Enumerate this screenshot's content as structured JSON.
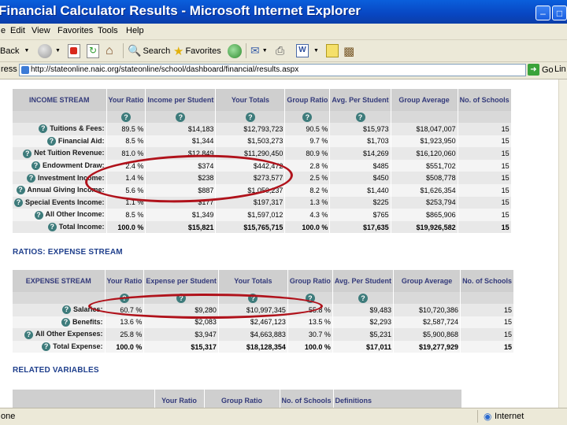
{
  "window": {
    "title": "Financial Calculator Results - Microsoft Internet Explorer"
  },
  "menu": [
    "Edit",
    "View",
    "Favorites",
    "Tools",
    "Help"
  ],
  "menu_fragment": "e",
  "toolbar": {
    "back": "Back",
    "search": "Search",
    "favorites": "Favorites"
  },
  "address": {
    "label_fragment": "ress",
    "url": "http://stateonline.naic.org/stateonline/school/dashboard/financial/results.aspx",
    "go": "Go",
    "links_fragment": "Lin"
  },
  "income": {
    "headers": [
      "INCOME STREAM",
      "Your Ratio",
      "Income per Student",
      "Your Totals",
      "Group Ratio",
      "Avg. Per Student",
      "Group Average",
      "No. of Schools"
    ],
    "rows": [
      [
        "Tuitions & Fees:",
        "89.5 %",
        "$14,183",
        "$12,793,723",
        "90.5 %",
        "$15,973",
        "$18,047,007",
        "15"
      ],
      [
        "Financial Aid:",
        "8.5 %",
        "$1,344",
        "$1,503,273",
        "9.7 %",
        "$1,703",
        "$1,923,950",
        "15"
      ],
      [
        "Net Tuition Revenue:",
        "81.0 %",
        "$12,849",
        "$11,290,450",
        "80.9 %",
        "$14,269",
        "$16,120,060",
        "15"
      ],
      [
        "Endowment Draw:",
        "2.4 %",
        "$374",
        "$442,472",
        "2.8 %",
        "$485",
        "$551,702",
        "15"
      ],
      [
        "Investment Income:",
        "1.4 %",
        "$238",
        "$273,577",
        "2.5 %",
        "$450",
        "$508,778",
        "15"
      ],
      [
        "Annual Giving Income:",
        "5.6 %",
        "$887",
        "$1,050,237",
        "8.2 %",
        "$1,440",
        "$1,626,354",
        "15"
      ],
      [
        "Special Events Income:",
        "1.1 %",
        "$177",
        "$197,317",
        "1.3 %",
        "$225",
        "$253,794",
        "15"
      ],
      [
        "All Other Income:",
        "8.5 %",
        "$1,349",
        "$1,597,012",
        "4.3 %",
        "$765",
        "$865,906",
        "15"
      ],
      [
        "Total Income:",
        "100.0 %",
        "$15,821",
        "$15,765,715",
        "100.0 %",
        "$17,635",
        "$19,926,582",
        "15"
      ]
    ]
  },
  "ratios_expense_title": "RATIOS: EXPENSE STREAM",
  "expense": {
    "headers": [
      "EXPENSE STREAM",
      "Your Ratio",
      "Expense per Student",
      "Your Totals",
      "Group Ratio",
      "Avg. Per Student",
      "Group Average",
      "No. of Schools"
    ],
    "rows": [
      [
        "Salaries:",
        "60.7 %",
        "$9,280",
        "$10,997,345",
        "55.8 %",
        "$9,483",
        "$10,720,386",
        "15"
      ],
      [
        "Benefits:",
        "13.6 %",
        "$2,083",
        "$2,467,123",
        "13.5 %",
        "$2,293",
        "$2,587,724",
        "15"
      ],
      [
        "All Other Expenses:",
        "25.8 %",
        "$3,947",
        "$4,663,883",
        "30.7 %",
        "$5,231",
        "$5,900,868",
        "15"
      ],
      [
        "Total Expense:",
        "100.0 %",
        "$15,317",
        "$18,128,354",
        "100.0 %",
        "$17,011",
        "$19,277,929",
        "15"
      ]
    ]
  },
  "related_title": "RELATED VARIABLES",
  "related": {
    "headers": [
      "",
      "Your Ratio",
      "Group Ratio",
      "No. of Schools",
      "Definitions"
    ]
  },
  "status": {
    "left": "one",
    "zone": "Internet"
  }
}
